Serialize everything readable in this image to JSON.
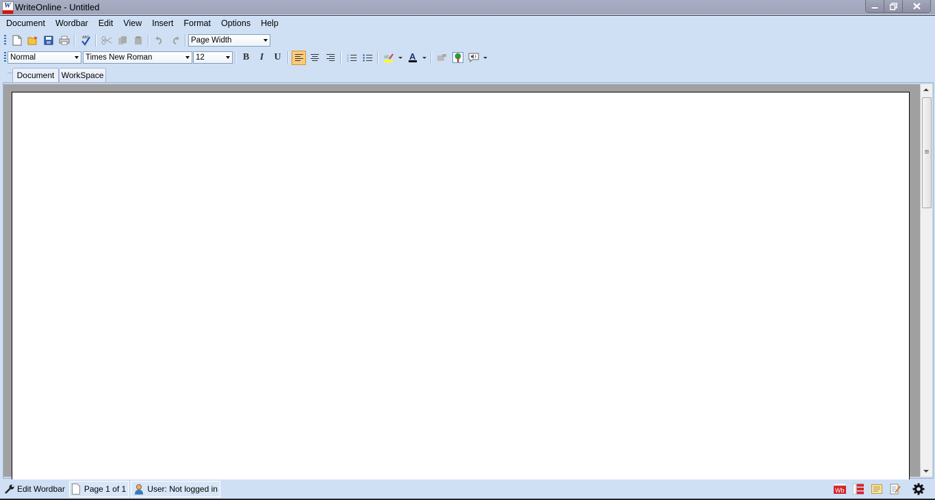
{
  "window": {
    "title": "WriteOnline - Untitled",
    "controls": {
      "minimize": "minimize",
      "restore": "restore",
      "close": "close"
    }
  },
  "menu": {
    "items": [
      "Document",
      "Wordbar",
      "Edit",
      "View",
      "Insert",
      "Format",
      "Options",
      "Help"
    ]
  },
  "toolbar1": {
    "buttons": [
      "new-document",
      "open",
      "save",
      "print",
      "spell-check",
      "cut",
      "copy",
      "paste",
      "undo",
      "redo"
    ],
    "zoom_select": {
      "value": "Page Width"
    }
  },
  "toolbar2": {
    "style_select": {
      "value": "Normal"
    },
    "font_select": {
      "value": "Times New Roman"
    },
    "size_select": {
      "value": "12"
    },
    "bold": "B",
    "italic": "I",
    "underline": "U",
    "alignment_active": "left",
    "highlight_color": "#ffff00",
    "font_color": "#000000"
  },
  "tabs": [
    {
      "label": "Document",
      "active": true
    },
    {
      "label": "WorkSpace",
      "active": false
    }
  ],
  "statusbar": {
    "edit_wordbar": "Edit Wordbar",
    "page": "Page 1 of 1",
    "user": "User: Not logged in"
  },
  "colors": {
    "chrome": "#cfe0f5",
    "active_button": "#fbcb7c",
    "doc_background": "#a0a0a0"
  }
}
